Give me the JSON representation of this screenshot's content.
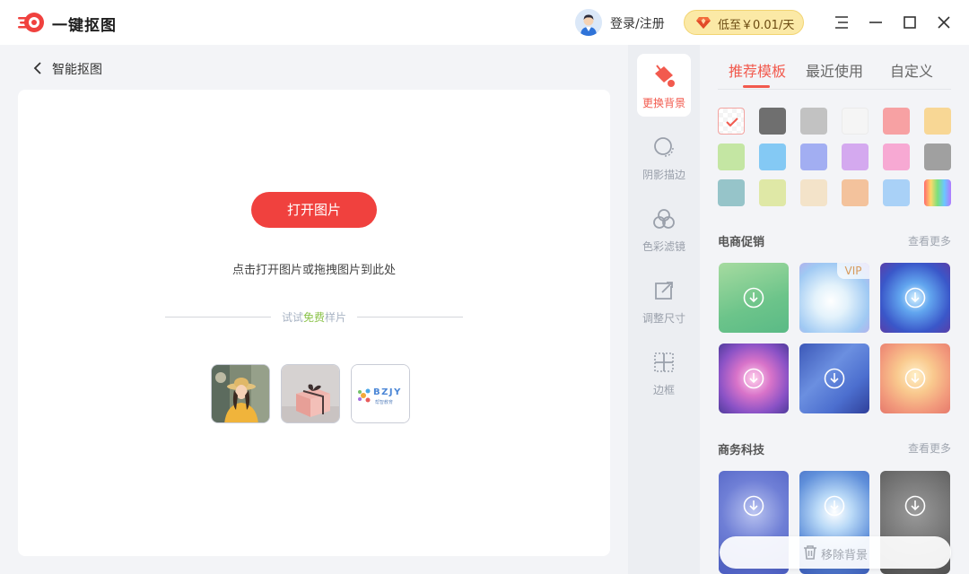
{
  "app": {
    "title": "一键抠图"
  },
  "header": {
    "login": "登录/注册",
    "vip_price": "低至￥0.01/天"
  },
  "left": {
    "back_label": "智能抠图",
    "open_button": "打开图片",
    "hint": "点击打开图片或拖拽图片到此处",
    "free_prefix": "试试",
    "free_highlight": "免费",
    "free_suffix": "样片",
    "sample_logo_text": "BZJY",
    "sample_logo_sub": "帮智教育"
  },
  "tools": [
    {
      "label": "更换背景",
      "icon": "paint-bucket-icon",
      "active": true
    },
    {
      "label": "阴影描边",
      "icon": "shadow-outline-icon",
      "active": false
    },
    {
      "label": "色彩滤镜",
      "icon": "color-filter-icon",
      "active": false
    },
    {
      "label": "调整尺寸",
      "icon": "resize-icon",
      "active": false
    },
    {
      "label": "边框",
      "icon": "border-icon",
      "active": false
    }
  ],
  "right": {
    "tabs": [
      "推荐模板",
      "最近使用",
      "自定义"
    ],
    "colors": [
      [
        "transparent",
        "#6f6f6f",
        "#c2c2c2",
        "#f5f5f5",
        "#f7a1a3",
        "#f8d795"
      ],
      [
        "#c4e6a3",
        "#84c9f4",
        "#a2aef2",
        "#d4a9ef",
        "#f7a9d3",
        "#a0a0a0"
      ],
      [
        "#96c4c9",
        "#dfe8a6",
        "#f3e3c9",
        "#f3c29c",
        "#a9d1f7",
        "rainbow"
      ]
    ],
    "section1": {
      "title": "电商促销",
      "more": "查看更多",
      "vip_badge": "VIP"
    },
    "section2": {
      "title": "商务科技",
      "more": "查看更多"
    },
    "remove_label": "移除背景"
  },
  "colors": {
    "accent": "#f0413e",
    "accent_text": "#f25a4e",
    "vip_bg": "#fbe9a6"
  }
}
